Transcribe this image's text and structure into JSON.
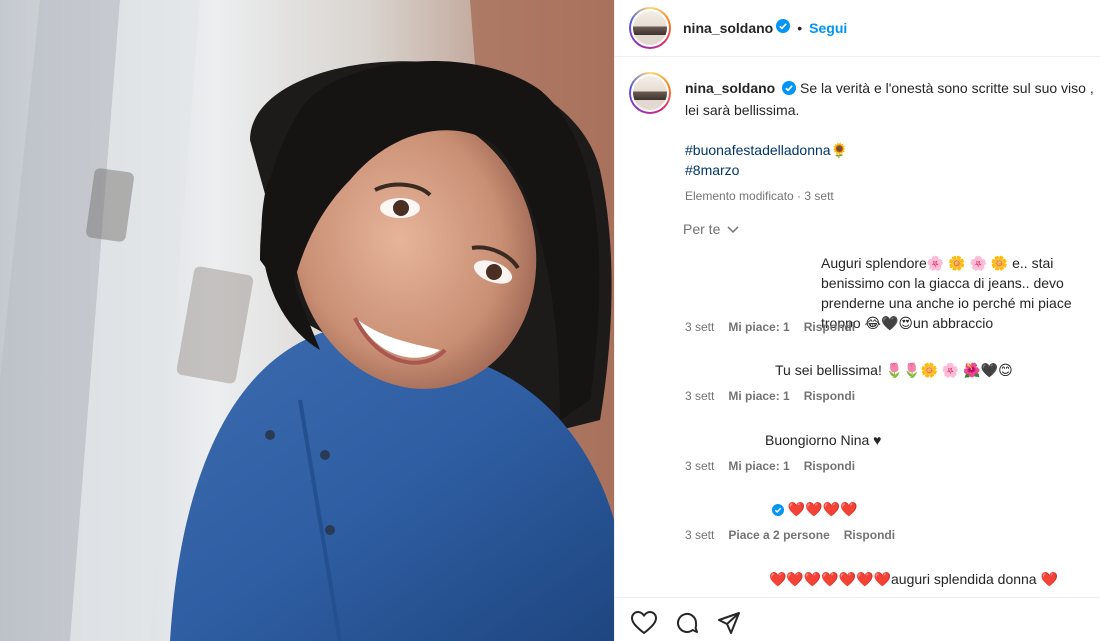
{
  "post": {
    "username": "nina_soldano",
    "dot": "•",
    "follow_label": "Segui",
    "caption": {
      "username": "nina_soldano",
      "text": "Se la verità e l'onestà sono scritte sul suo viso , lei sarà bellissima.",
      "hashtag1": "#buonafestadelladonna🌻",
      "hashtag2": "#8marzo",
      "edited": "Elemento modificato · 3 sett"
    },
    "sort_label": "Per te",
    "comments": [
      {
        "text": "Auguri splendore🌸 🌼 🌸 🌼 e.. stai benissimo con la giacca di jeans.. devo prenderne una anche io perché mi piace troppo 😂🖤😍un abbraccio",
        "age": "3 sett",
        "likes": "Mi piace: 1",
        "reply": "Rispondi"
      },
      {
        "text": "Tu sei bellissima! 🌷🌷🌼 🌸 🌺🖤😊",
        "age": "3 sett",
        "likes": "Mi piace: 1",
        "reply": "Rispondi"
      },
      {
        "text": "Buongiorno Nina ♥",
        "age": "3 sett",
        "likes": "Mi piace: 1",
        "reply": "Rispondi"
      },
      {
        "text": "❤️❤️❤️❤️",
        "age": "3 sett",
        "likes": "Piace a 2 persone",
        "reply": "Rispondi"
      },
      {
        "text": "❤️❤️❤️❤️❤️❤️❤️auguri splendida donna ❤️"
      }
    ]
  },
  "icons": {
    "like": "heart-icon",
    "comment": "comment-icon",
    "share": "send-icon"
  },
  "colors": {
    "accent": "#0095f6",
    "hashtag": "#00376b",
    "muted": "#737373",
    "text": "#262626",
    "verified": "#0095f6"
  }
}
